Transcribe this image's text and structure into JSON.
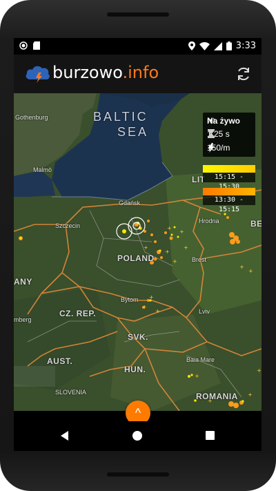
{
  "status_bar": {
    "time": "3:33",
    "left_icons": [
      "record-icon",
      "sd-card-icon"
    ],
    "right_icons": [
      "location-icon",
      "wifi-icon",
      "signal-icon",
      "battery-icon"
    ]
  },
  "app_bar": {
    "brand_main": "burzowo",
    "brand_suffix": ".info",
    "brand_color": "#ff7a1a",
    "refresh_icon": "refresh-icon"
  },
  "map": {
    "sea_label_1": "BALTIC",
    "sea_label_2": "SEA",
    "labels": {
      "gothenburg": "Gothenburg",
      "malmo": "Malmö",
      "gdansk": "Gdańsk",
      "szczecin": "Szczecin",
      "poland": "POLAND",
      "bytom": "Bytom",
      "czrep": "CZ. REP.",
      "svk": "SVK.",
      "hun": "HUN.",
      "aust": "AUST.",
      "slovenia": "SLOVENIA",
      "romania": "ROMANIA",
      "hrodna": "Hrodna",
      "brest": "Brest",
      "lviv": "Lviv",
      "baia_mare": "Baia Mare",
      "lit": "LIT",
      "bel": "BE",
      "gny": "ANY",
      "mberg": "mberg"
    }
  },
  "live_panel": {
    "title": "Na żywo",
    "interval": "1.25 s",
    "rate": "150/m"
  },
  "legend": {
    "range1": "15:15 - 15:30",
    "range2": "13:30 - 15:15",
    "color1": "#fff600",
    "color2": "#ff7a00"
  },
  "fab": {
    "label": "^"
  },
  "nav": {
    "back": "back-icon",
    "home": "home-icon",
    "recents": "recents-icon"
  }
}
